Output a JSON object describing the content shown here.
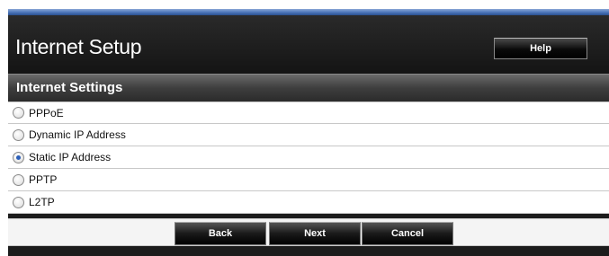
{
  "header": {
    "title": "Internet Setup",
    "help_label": "Help"
  },
  "section": {
    "title": "Internet Settings"
  },
  "options": [
    {
      "label": "PPPoE",
      "checked": false
    },
    {
      "label": "Dynamic IP Address",
      "checked": false
    },
    {
      "label": "Static IP Address",
      "checked": true
    },
    {
      "label": "PPTP",
      "checked": false
    },
    {
      "label": "L2TP",
      "checked": false
    }
  ],
  "footer": {
    "back_label": "Back",
    "next_label": "Next",
    "cancel_label": "Cancel"
  },
  "colors": {
    "header_bg": "#1c1c1c",
    "accent_strip": "#4a74b8",
    "radio_selected": "#2c5fb8"
  }
}
